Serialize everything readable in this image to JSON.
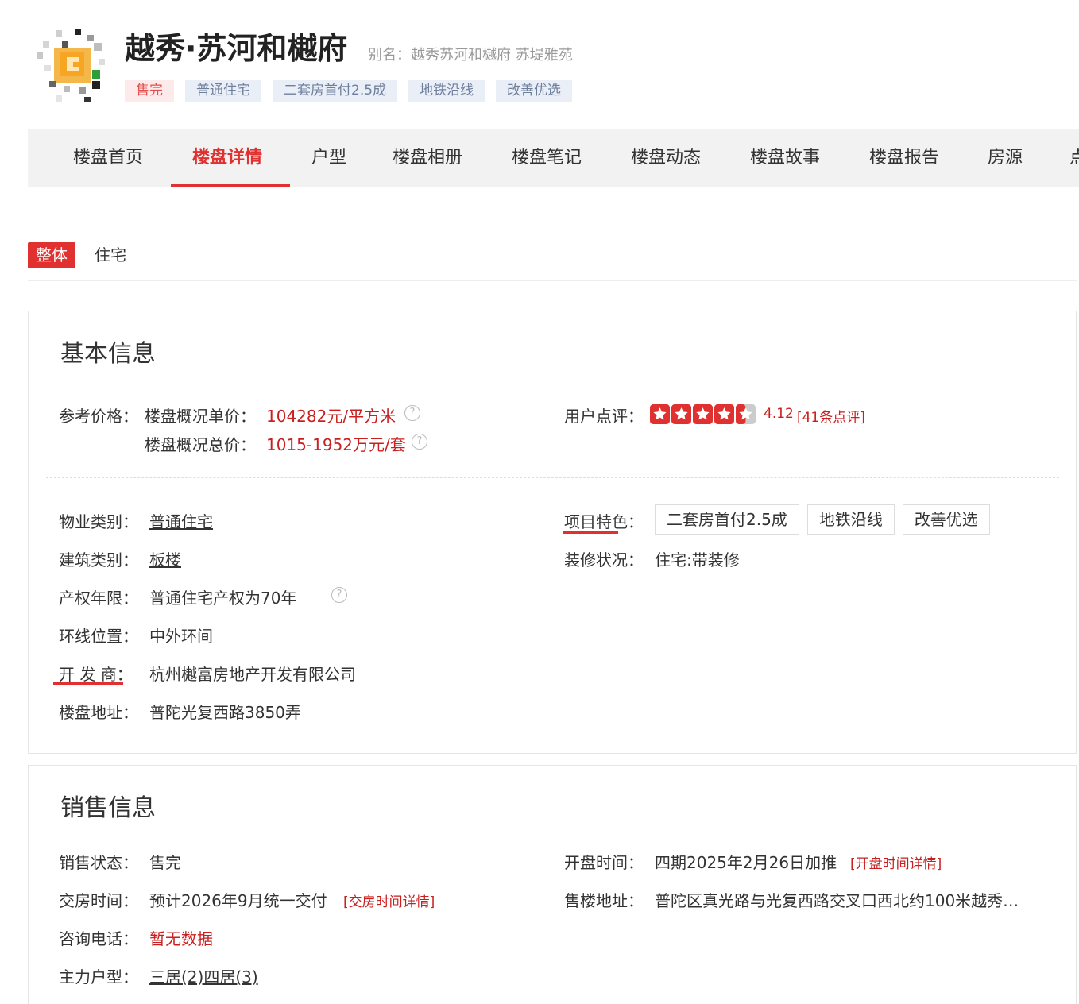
{
  "header": {
    "title": "越秀·苏河和樾府",
    "alias": "别名：越秀苏河和樾府 苏堤雅苑",
    "tags": [
      "售完",
      "普通住宅",
      "二套房首付2.5成",
      "地铁沿线",
      "改善优选"
    ]
  },
  "nav": {
    "items": [
      "楼盘首页",
      "楼盘详情",
      "户型",
      "楼盘相册",
      "楼盘笔记",
      "楼盘动态",
      "楼盘故事",
      "楼盘报告",
      "房源",
      "点"
    ],
    "active_index": 1
  },
  "category": {
    "active": "整体",
    "other": "住宅"
  },
  "basic_info": {
    "title": "基本信息",
    "price_label": "参考价格：",
    "unit_price_label": "楼盘概况单价：",
    "unit_price_value": "104282元/平方米",
    "total_price_label": "楼盘概况总价：",
    "total_price_value": "1015-1952万元/套",
    "rating_label": "用户点评：",
    "rating_score": "4.12",
    "rating_stars": 4.12,
    "rating_count": "[41条点评]",
    "property_type_label": "物业类别：",
    "property_type_value": "普通住宅",
    "building_type_label": "建筑类别：",
    "building_type_value": "板楼",
    "tenure_label": "产权年限：",
    "tenure_value": "普通住宅产权为70年",
    "ring_label": "环线位置：",
    "ring_value": "中外环间",
    "developer_label": "开 发 商：",
    "developer_value": "杭州樾富房地产开发有限公司",
    "address_label": "楼盘地址：",
    "address_value": "普陀光复西路3850弄",
    "features_label": "项目特色：",
    "features": [
      "二套房首付2.5成",
      "地铁沿线",
      "改善优选"
    ],
    "decoration_label": "装修状况：",
    "decoration_value": "住宅:带装修"
  },
  "sales_info": {
    "title": "销售信息",
    "status_label": "销售状态：",
    "status_value": "售完",
    "delivery_label": "交房时间：",
    "delivery_value": "预计2026年9月统一交付",
    "delivery_link": "[交房时间详情]",
    "phone_label": "咨询电话：",
    "phone_value": "暂无数据",
    "main_type_label": "主力户型：",
    "main_type_value": "三居(2)四居(3)",
    "opening_label": "开盘时间：",
    "opening_value": "四期2025年2月26日加推",
    "opening_link": "[开盘时间详情]",
    "sales_address_label": "售楼地址：",
    "sales_address_value": "普陀区真光路与光复西路交叉口西北约100米越秀…"
  },
  "colors": {
    "accent": "#e0302f",
    "price_red": "#c91f1f",
    "tag_bg": "#e9eef7",
    "tag_text": "#6e7f9c",
    "nav_bg": "#f2f2f2"
  }
}
